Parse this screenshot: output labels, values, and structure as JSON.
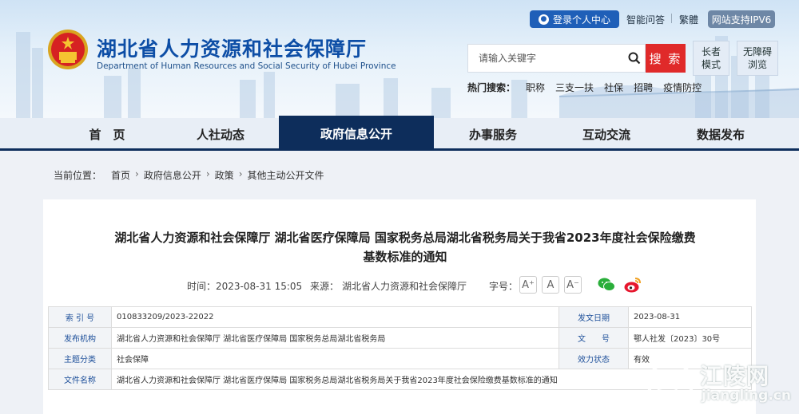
{
  "header": {
    "title": "湖北省人力资源和社会保障厅",
    "subtitle": "Department of Human Resources and Social Security of Hubei Province",
    "login": "登录个人中心",
    "qa": "智能问答",
    "traditional": "繁體",
    "ipv6": "网站支持IPV6",
    "search_placeholder": "请输入关键字",
    "search_button": "搜 索",
    "elder_line1": "长者",
    "elder_line2": "模式",
    "access_line1": "无障碍",
    "access_line2": "浏览",
    "hot_label": "热门搜索：",
    "hot_items": [
      "职称",
      "三支一扶",
      "社保",
      "招聘",
      "疫情防控"
    ]
  },
  "nav": {
    "items": [
      "首　页",
      "人社动态",
      "政府信息公开",
      "办事服务",
      "互动交流",
      "数据发布"
    ],
    "active_index": 2
  },
  "breadcrumb": {
    "label": "当前位置：",
    "items": [
      "首页",
      "政府信息公开",
      "政策",
      "其他主动公开文件"
    ]
  },
  "article": {
    "title_line1": "湖北省人力资源和社会保障厅 湖北省医疗保障局 国家税务总局湖北省税务局关于我省2023年度社会保险缴费",
    "title_line2": "基数标准的通知",
    "time_label": "时间：",
    "time": "2023-08-31 15:05",
    "source_label": "来源：",
    "source": "湖北省人力资源和社会保障厅",
    "font_label": "字号：",
    "font_sizes": [
      "A⁺",
      "A",
      "A⁻"
    ]
  },
  "info": {
    "index_label": "索 引 号",
    "index": "010833209/2023-22022",
    "date_label": "发文日期",
    "date": "2023-08-31",
    "org_label": "发布机构",
    "org": "湖北省人力资源和社会保障厅 湖北省医疗保障局 国家税务总局湖北省税务局",
    "doc_label": "文　　号",
    "doc": "鄂人社发〔2023〕30号",
    "topic_label": "主题分类",
    "topic": "社会保障",
    "status_label": "效力状态",
    "status": "有效",
    "name_label": "文件名称",
    "name": "湖北省人力资源和社会保障厅 湖北省医疗保障局 国家税务总局湖北省税务局关于我省2023年度社会保险缴费基数标准的通知"
  },
  "watermark": {
    "text": "江陵网",
    "url": "jiangling.cn"
  },
  "colors": {
    "brand_blue": "#0d4ea6",
    "nav_active": "#0d2d5b",
    "search_red": "#e02a2a"
  }
}
